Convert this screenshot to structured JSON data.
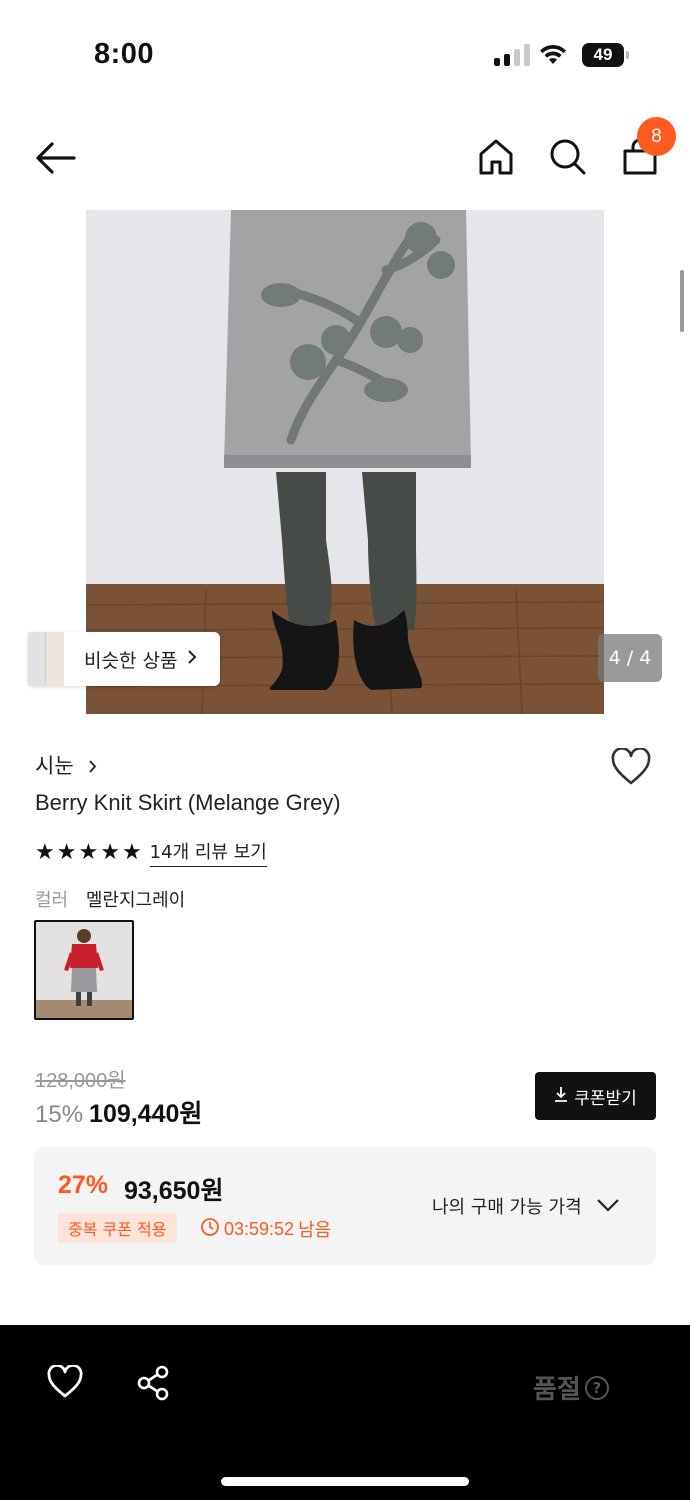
{
  "status_bar": {
    "time": "8:00",
    "battery": "49"
  },
  "nav": {
    "cart_count": "8",
    "icons": [
      "back-arrow-icon",
      "home-icon",
      "search-icon",
      "cart-icon"
    ]
  },
  "gallery": {
    "similar_label": "비슷한 상품",
    "counter": "4 / 4"
  },
  "product": {
    "brand": "시눈",
    "title": "Berry Knit Skirt (Melange Grey)",
    "rating_stars": 5,
    "review_link": "14개 리뷰 보기",
    "color_label": "컬러",
    "color_value": "멜란지그레이"
  },
  "price": {
    "original": "128,000원",
    "discount_pct": "15%",
    "sale_amount": "109,440원",
    "coupon_button": "쿠폰받기"
  },
  "best_price": {
    "pct": "27%",
    "amount": "93,650원",
    "badge": "중복 쿠폰 적용",
    "timer": "03:59:52",
    "timer_suffix": "남음",
    "my_price_label": "나의 구매 가능 가격"
  },
  "bottom_bar": {
    "sold_out_label": "품절",
    "icons": [
      "heart-icon",
      "share-icon",
      "question-icon"
    ]
  },
  "colors": {
    "accent": "#ff5a1f",
    "dark": "#111111",
    "panel": "#f4f4f4"
  }
}
